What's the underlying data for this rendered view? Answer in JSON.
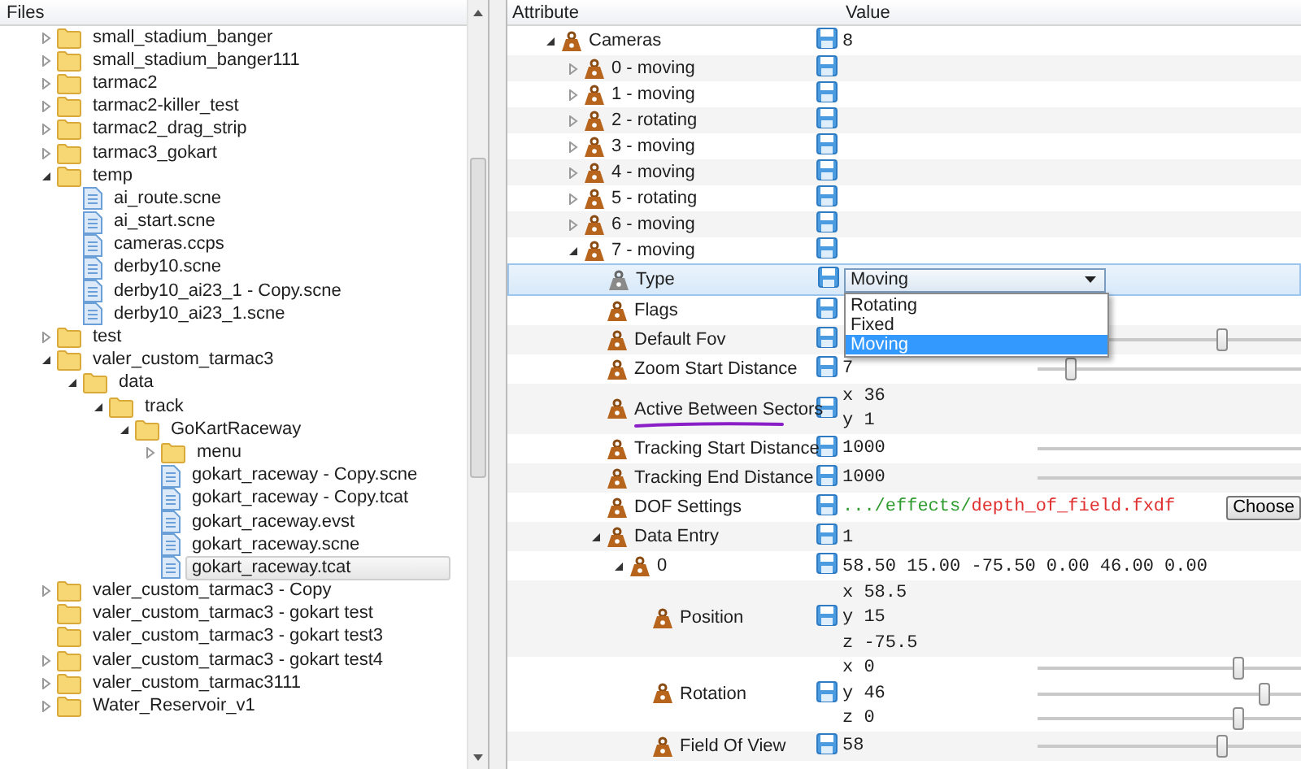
{
  "files_panel": {
    "title": "Files",
    "items": [
      {
        "name": "small_stadium_banger",
        "kind": "folder",
        "expanded": false,
        "selected": false
      },
      {
        "name": "small_stadium_banger111",
        "kind": "folder",
        "expanded": false,
        "selected": false
      },
      {
        "name": "tarmac2",
        "kind": "folder",
        "expanded": false,
        "selected": false
      },
      {
        "name": "tarmac2-killer_test",
        "kind": "folder",
        "expanded": false,
        "selected": false
      },
      {
        "name": "tarmac2_drag_strip",
        "kind": "folder",
        "expanded": false,
        "selected": false
      },
      {
        "name": "tarmac3_gokart",
        "kind": "folder",
        "expanded": false,
        "selected": false
      },
      {
        "name": "temp",
        "kind": "folder",
        "expanded": true,
        "selected": false,
        "children": [
          {
            "name": "ai_route.scne",
            "kind": "file",
            "selected": false
          },
          {
            "name": "ai_start.scne",
            "kind": "file",
            "selected": false
          },
          {
            "name": "cameras.ccps",
            "kind": "file",
            "selected": false
          },
          {
            "name": "derby10.scne",
            "kind": "file",
            "selected": false
          },
          {
            "name": "derby10_ai23_1 - Copy.scne",
            "kind": "file",
            "selected": false
          },
          {
            "name": "derby10_ai23_1.scne",
            "kind": "file",
            "selected": false
          }
        ]
      },
      {
        "name": "test",
        "kind": "folder",
        "expanded": false,
        "selected": false
      },
      {
        "name": "valer_custom_tarmac3",
        "kind": "folder",
        "expanded": true,
        "selected": false,
        "children": [
          {
            "name": "data",
            "kind": "folder",
            "expanded": true,
            "selected": false,
            "children": [
              {
                "name": "track",
                "kind": "folder",
                "expanded": true,
                "selected": false,
                "children": [
                  {
                    "name": "GoKartRaceway",
                    "kind": "folder",
                    "expanded": true,
                    "selected": false,
                    "children": [
                      {
                        "name": "menu",
                        "kind": "folder",
                        "expanded": false,
                        "selected": false
                      },
                      {
                        "name": "gokart_raceway - Copy.scne",
                        "kind": "file",
                        "selected": false
                      },
                      {
                        "name": "gokart_raceway - Copy.tcat",
                        "kind": "file",
                        "selected": false
                      },
                      {
                        "name": "gokart_raceway.evst",
                        "kind": "file",
                        "selected": false
                      },
                      {
                        "name": "gokart_raceway.scne",
                        "kind": "file",
                        "selected": false
                      },
                      {
                        "name": "gokart_raceway.tcat",
                        "kind": "file",
                        "selected": true
                      }
                    ]
                  }
                ]
              }
            ]
          }
        ]
      },
      {
        "name": "valer_custom_tarmac3 - Copy",
        "kind": "folder",
        "expanded": false,
        "selected": false
      },
      {
        "name": "valer_custom_tarmac3 - gokart test",
        "kind": "folder",
        "selected": false
      },
      {
        "name": "valer_custom_tarmac3 - gokart test3",
        "kind": "folder",
        "selected": false
      },
      {
        "name": "valer_custom_tarmac3 - gokart test4",
        "kind": "folder",
        "expanded": false,
        "selected": false
      },
      {
        "name": "valer_custom_tarmac3111",
        "kind": "folder",
        "expanded": false,
        "selected": false
      },
      {
        "name": "Water_Reservoir_v1",
        "kind": "folder",
        "expanded": false,
        "selected": false
      }
    ]
  },
  "attributes_panel": {
    "columns": [
      "Attribute",
      "Value"
    ],
    "rows": [
      {
        "label": "Cameras",
        "kind": "text",
        "value": "8",
        "expanded": true,
        "selected": false,
        "children": [
          {
            "label": "0 - moving",
            "kind": "blank",
            "expanded": false,
            "selected": false
          },
          {
            "label": "1 - moving",
            "kind": "blank",
            "expanded": false,
            "selected": false
          },
          {
            "label": "2 - rotating",
            "kind": "blank",
            "expanded": false,
            "selected": false
          },
          {
            "label": "3 - moving",
            "kind": "blank",
            "expanded": false,
            "selected": false
          },
          {
            "label": "4 - moving",
            "kind": "blank",
            "expanded": false,
            "selected": false
          },
          {
            "label": "5 - rotating",
            "kind": "blank",
            "expanded": false,
            "selected": false
          },
          {
            "label": "6 - moving",
            "kind": "blank",
            "expanded": false,
            "selected": false
          },
          {
            "label": "7 - moving",
            "kind": "blank",
            "expanded": true,
            "selected": false,
            "children": [
              {
                "label": "Type",
                "kind": "dropdown",
                "value": "Moving",
                "selected": true,
                "open": true,
                "options": [
                  {
                    "label": "Rotating",
                    "selected": false
                  },
                  {
                    "label": "Fixed",
                    "selected": false
                  },
                  {
                    "label": "Moving",
                    "selected": true
                  }
                ]
              },
              {
                "label": "Flags",
                "kind": "blank",
                "selected": false
              },
              {
                "label": "Default Fov",
                "kind": "slider",
                "level": 0.7,
                "selected": false
              },
              {
                "label": "Zoom Start Distance",
                "kind": "slider",
                "value": "7",
                "level": 0.125,
                "selected": false
              },
              {
                "label": "Active Between Sectors",
                "kind": "vector",
                "lines": [
                  {
                    "text": "x 36"
                  },
                  {
                    "text": "y 1"
                  }
                ],
                "underlined": true,
                "selected": false
              },
              {
                "label": "Tracking Start Distance",
                "kind": "slider",
                "value": "1000",
                "selected": false
              },
              {
                "label": "Tracking End Distance",
                "kind": "slider",
                "value": "1000",
                "selected": false
              },
              {
                "label": "DOF Settings",
                "kind": "path",
                "directory": ".../effects/",
                "file": "depth_of_field.fxdf",
                "button": "Choose",
                "selected": false
              },
              {
                "label": "Data Entry",
                "kind": "text",
                "value": "1",
                "expanded": true,
                "selected": false,
                "children": [
                  {
                    "label": "0",
                    "kind": "text",
                    "value": "58.50 15.00 -75.50 0.00 46.00 0.00",
                    "expanded": true,
                    "selected": false,
                    "children": [
                      {
                        "label": "Position",
                        "kind": "vector",
                        "lines": [
                          {
                            "text": "x 58.5"
                          },
                          {
                            "text": "y 15"
                          },
                          {
                            "text": "z -75.5"
                          }
                        ],
                        "selected": false
                      },
                      {
                        "label": "Rotation",
                        "kind": "vector",
                        "lines": [
                          {
                            "text": "x 0",
                            "level": 0.76
                          },
                          {
                            "text": "y 46",
                            "level": 0.86
                          },
                          {
                            "text": "z 0",
                            "level": 0.76
                          }
                        ],
                        "selected": false
                      },
                      {
                        "label": "Field Of View",
                        "kind": "slider",
                        "value": "58",
                        "level": 0.7,
                        "selected": false
                      }
                    ]
                  }
                ]
              }
            ]
          }
        ]
      }
    ]
  }
}
